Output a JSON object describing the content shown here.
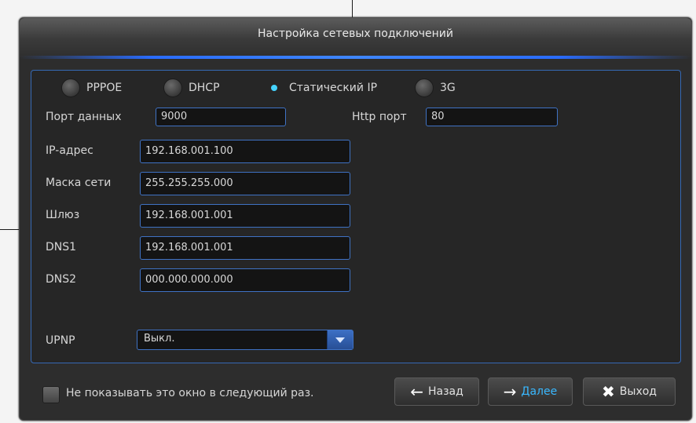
{
  "dialog": {
    "title": "Настройка сетевых подключений"
  },
  "network_mode": {
    "options": [
      {
        "label": "PPPOE",
        "selected": false
      },
      {
        "label": "DHCP",
        "selected": false
      },
      {
        "label": "Статический IP",
        "selected": true
      },
      {
        "label": "3G",
        "selected": false
      }
    ]
  },
  "ports": {
    "data_port_label": "Порт данных",
    "data_port_value": "9000",
    "http_port_label": "Http порт",
    "http_port_value": "80"
  },
  "ip": {
    "address_label": "IP-адрес",
    "address_value": "192.168.001.100",
    "mask_label": "Маска сети",
    "mask_value": "255.255.255.000",
    "gateway_label": "Шлюз",
    "gateway_value": "192.168.001.001",
    "dns1_label": "DNS1",
    "dns1_value": "192.168.001.001",
    "dns2_label": "DNS2",
    "dns2_value": "000.000.000.000"
  },
  "upnp": {
    "label": "UPNP",
    "value": "Выкл."
  },
  "footer": {
    "dont_show_label": "Не показывать это окно в следующий раз.",
    "back_label": "Назад",
    "next_label": "Далее",
    "exit_label": "Выход"
  },
  "colors": {
    "accent": "#3f72c4",
    "selected_radio": "#45d3ff",
    "next_text": "#39b8ff"
  },
  "icons": {
    "back": "arrow-left-icon",
    "next": "arrow-right-icon",
    "exit": "close-icon",
    "dropdown": "chevron-down-icon"
  }
}
